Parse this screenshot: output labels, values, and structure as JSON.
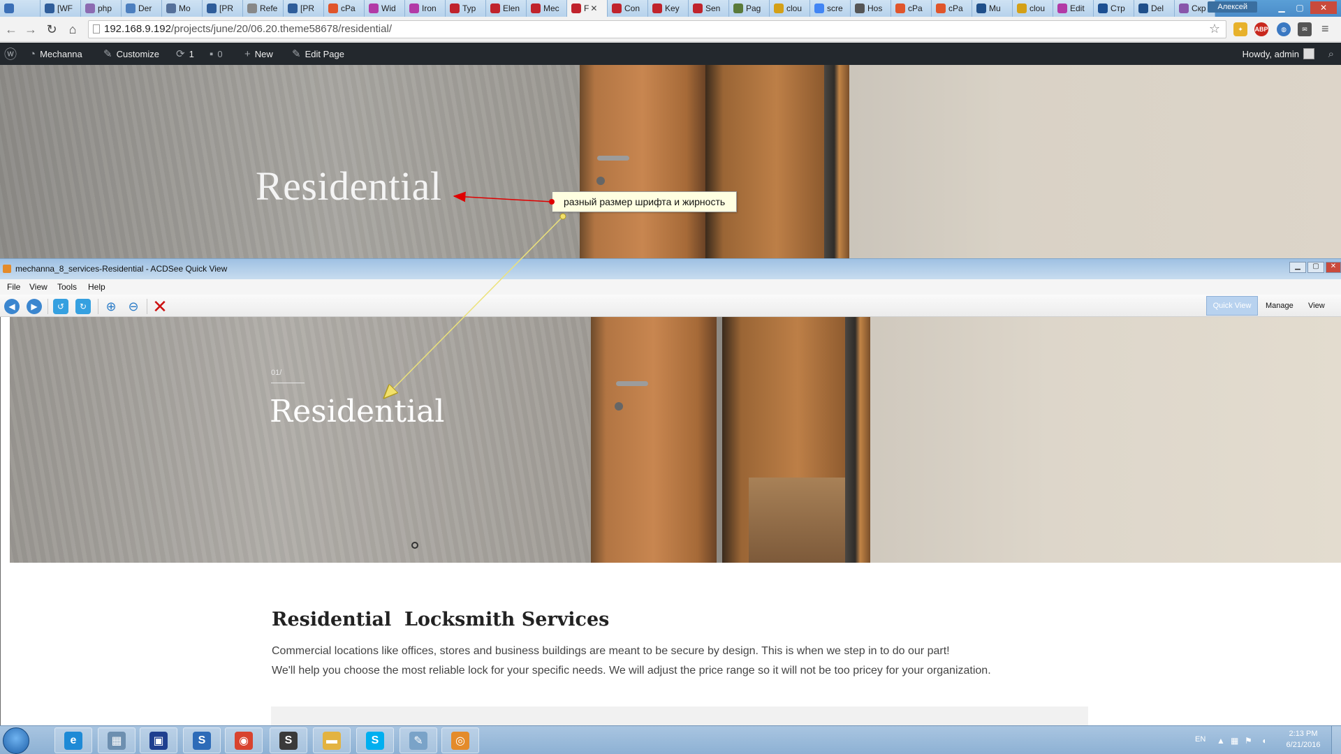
{
  "browser": {
    "tabs": [
      {
        "label": "",
        "icon": "mail-icon",
        "color": "#3b6fb6"
      },
      {
        "label": "[WF",
        "icon": "wrench-icon",
        "color": "#2f5d9a"
      },
      {
        "label": "php",
        "icon": "elephant-icon",
        "color": "#8c6bb1"
      },
      {
        "label": "Der",
        "icon": "chat-icon",
        "color": "#4c7fbf"
      },
      {
        "label": "Mo",
        "icon": "chat-icon",
        "color": "#55709a"
      },
      {
        "label": "[PR",
        "icon": "wrench-icon",
        "color": "#2f5d9a"
      },
      {
        "label": "Refe",
        "icon": "page-icon",
        "color": "#888888"
      },
      {
        "label": "[PR",
        "icon": "wrench-icon",
        "color": "#2f5d9a"
      },
      {
        "label": "cPa",
        "icon": "cpanel-icon",
        "color": "#e0552b"
      },
      {
        "label": "Wid",
        "icon": "instagram-icon",
        "color": "#b23aa6"
      },
      {
        "label": "Iron",
        "icon": "instagram-icon",
        "color": "#b23aa6"
      },
      {
        "label": "Typ",
        "icon": "m-icon",
        "color": "#c0232c"
      },
      {
        "label": "Elen",
        "icon": "m-icon",
        "color": "#c0232c"
      },
      {
        "label": "Mec",
        "icon": "m-icon",
        "color": "#c0232c"
      },
      {
        "label": "F",
        "icon": "m-icon",
        "color": "#c0232c",
        "active": true
      },
      {
        "label": "Con",
        "icon": "m-icon",
        "color": "#c0232c"
      },
      {
        "label": "Key",
        "icon": "m-icon",
        "color": "#c0232c"
      },
      {
        "label": "Sen",
        "icon": "m-icon",
        "color": "#c0232c"
      },
      {
        "label": "Pag",
        "icon": "pages-icon",
        "color": "#5a7a3a"
      },
      {
        "label": "clou",
        "icon": "rma-icon",
        "color": "#d4a017"
      },
      {
        "label": "scre",
        "icon": "google-icon",
        "color": "#4285f4"
      },
      {
        "label": "Hos",
        "icon": "host-icon",
        "color": "#555555"
      },
      {
        "label": "cPa",
        "icon": "cpanel-icon",
        "color": "#e0552b"
      },
      {
        "label": "cPa",
        "icon": "cpanel-icon",
        "color": "#e0552b"
      },
      {
        "label": "Mu",
        "icon": "monitor-icon",
        "color": "#1f4f8a"
      },
      {
        "label": "clou",
        "icon": "rma-icon",
        "color": "#d4a017"
      },
      {
        "label": "Edit",
        "icon": "instagram-icon",
        "color": "#b23aa6"
      },
      {
        "label": "Стр",
        "icon": "x-icon",
        "color": "#1c4f92"
      },
      {
        "label": "Del",
        "icon": "monitor-icon",
        "color": "#1f4f8a"
      },
      {
        "label": "Скр",
        "icon": "pen-icon",
        "color": "#8855aa"
      }
    ],
    "tab_close": "✕",
    "window_user": "Алексей",
    "url_host": "192.168.9.192",
    "url_path": "/projects/june/20/06.20.theme58678/residential/"
  },
  "adminbar": {
    "site_name": "Mechanna",
    "customize": "Customize",
    "updates_count": "1",
    "comments_count": "0",
    "new_label": "New",
    "edit_page": "Edit Page",
    "howdy": "Howdy, admin"
  },
  "hero_top": {
    "title": "Residential"
  },
  "annotation": {
    "text": "разный размер шрифта и жирность"
  },
  "acdsee": {
    "title": "mechanna_8_services-Residential - ACDSee Quick View",
    "menu": {
      "file": "File",
      "view": "View",
      "tools": "Tools",
      "help": "Help"
    },
    "modes": {
      "quick_view": "Quick View",
      "manage": "Manage",
      "view": "View"
    }
  },
  "mockup": {
    "slide_number": "01/",
    "hero_title": "Residential",
    "section_title": "Residential  Locksmith Services",
    "paragraph_1": "Commercial locations like offices, stores and business buildings are meant to be secure by design. This is when we step in to do our part!",
    "paragraph_2": "We'll help you choose the most reliable lock for your specific needs. We will adjust the price range so it will not be too pricey for your organization."
  },
  "taskbar": {
    "apps": [
      {
        "name": "ie",
        "icon": "ie-icon",
        "color": "#1e8ad6",
        "glyph": "e"
      },
      {
        "name": "calculator",
        "icon": "calculator-icon",
        "color": "#6d8fb0",
        "glyph": "▦"
      },
      {
        "name": "save",
        "icon": "floppy-icon",
        "color": "#1f3f8f",
        "glyph": "▣"
      },
      {
        "name": "s-app",
        "icon": "s-icon",
        "color": "#2d6bb8",
        "glyph": "S"
      },
      {
        "name": "chrome",
        "icon": "chrome-icon",
        "color": "#d8432f",
        "glyph": "◉"
      },
      {
        "name": "sublime",
        "icon": "sublime-icon",
        "color": "#3a3a3a",
        "glyph": "S"
      },
      {
        "name": "explorer",
        "icon": "folder-icon",
        "color": "#e3b341",
        "glyph": "▬"
      },
      {
        "name": "skype",
        "icon": "skype-icon",
        "color": "#00aff0",
        "glyph": "S"
      },
      {
        "name": "notes",
        "icon": "notepad-icon",
        "color": "#7aa3c8",
        "glyph": "✎"
      },
      {
        "name": "acdsee",
        "icon": "acdsee-icon",
        "color": "#e48b2a",
        "glyph": "◎"
      }
    ],
    "lang": "EN",
    "time": "2:13 PM",
    "date": "6/21/2016"
  }
}
